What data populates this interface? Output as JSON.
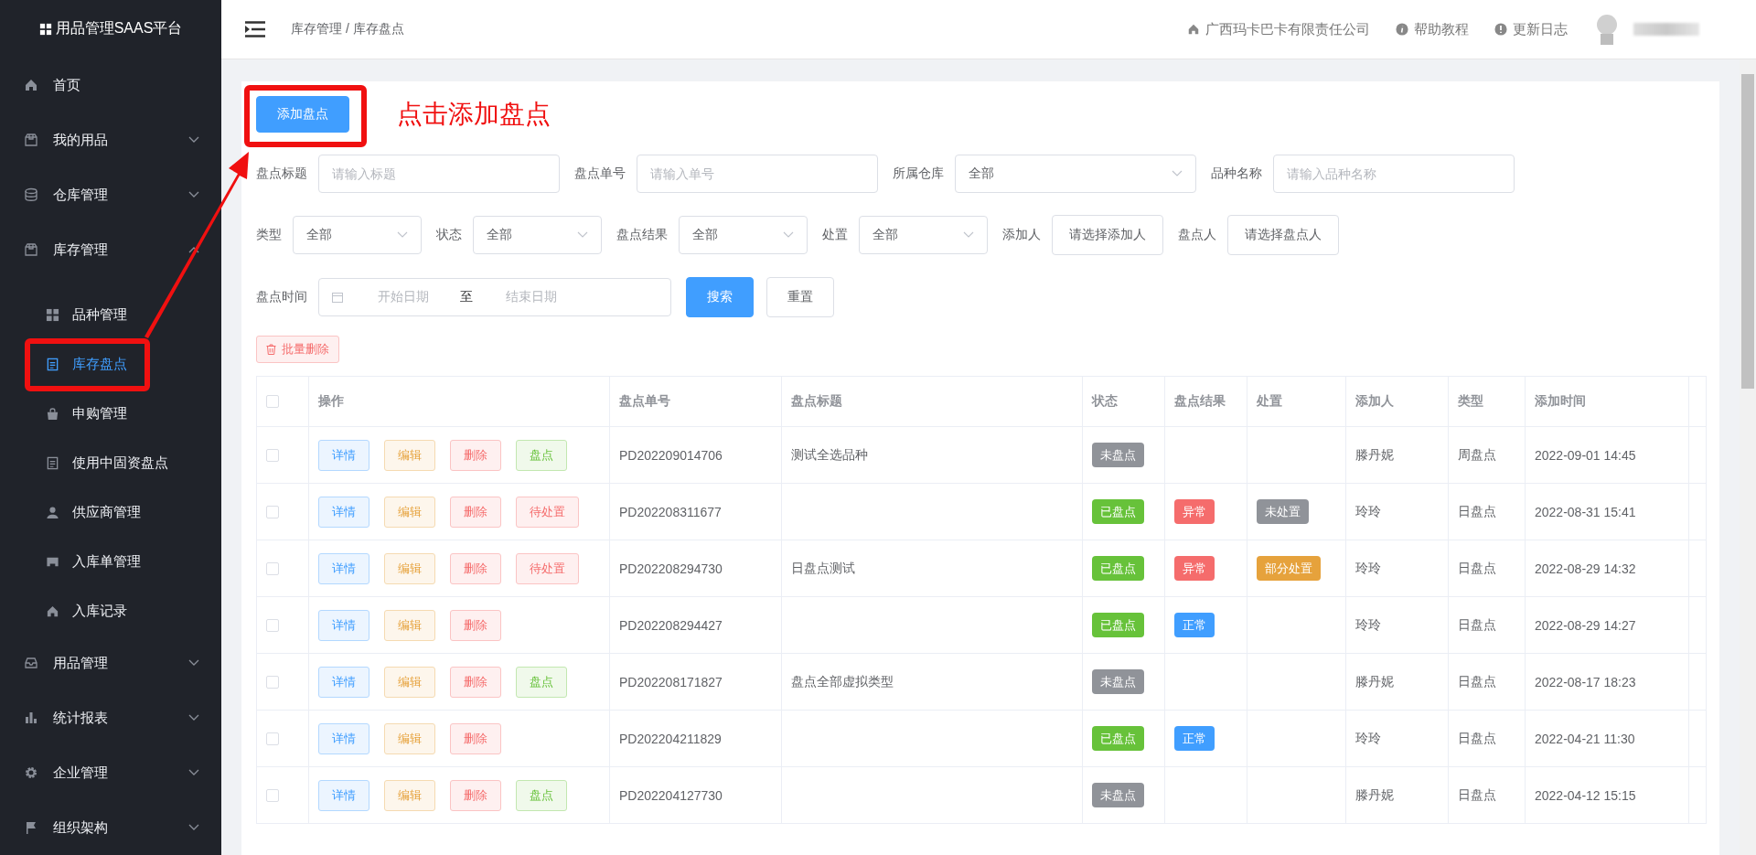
{
  "sidebar": {
    "logo": "用品管理SAAS平台",
    "items": [
      {
        "label": "首页",
        "kind": "link"
      },
      {
        "label": "我的用品",
        "kind": "group",
        "expanded": false
      },
      {
        "label": "仓库管理",
        "kind": "group",
        "expanded": false
      },
      {
        "label": "库存管理",
        "kind": "group",
        "expanded": true,
        "children": [
          {
            "label": "品种管理",
            "selected": false
          },
          {
            "label": "库存盘点",
            "selected": true
          },
          {
            "label": "申购管理",
            "selected": false
          },
          {
            "label": "使用中固资盘点",
            "selected": false
          },
          {
            "label": "供应商管理",
            "selected": false
          },
          {
            "label": "入库单管理",
            "selected": false
          },
          {
            "label": "入库记录",
            "selected": false
          }
        ]
      },
      {
        "label": "用品管理",
        "kind": "group",
        "expanded": false
      },
      {
        "label": "统计报表",
        "kind": "group",
        "expanded": false
      },
      {
        "label": "企业管理",
        "kind": "group",
        "expanded": false
      },
      {
        "label": "组织架构",
        "kind": "group",
        "expanded": false
      }
    ]
  },
  "header": {
    "breadcrumb": "库存管理 / 库存盘点",
    "company": "广西玛卡巴卡有限责任公司",
    "help": "帮助教程",
    "changelog": "更新日志"
  },
  "add_button": "添加盘点",
  "annotation": "点击添加盘点",
  "filters": [
    [
      {
        "label": "盘点标题",
        "kind": "input",
        "placeholder": "请输入标题"
      },
      {
        "label": "盘点单号",
        "kind": "input",
        "placeholder": "请输入单号"
      },
      {
        "label": "所属仓库",
        "kind": "select",
        "value": "全部"
      },
      {
        "label": "品种名称",
        "kind": "input",
        "placeholder": "请输入品种名称"
      }
    ],
    [
      {
        "label": "类型",
        "kind": "select",
        "value": "全部"
      },
      {
        "label": "状态",
        "kind": "select",
        "value": "全部"
      },
      {
        "label": "盘点结果",
        "kind": "select",
        "value": "全部"
      },
      {
        "label": "处置",
        "kind": "select",
        "value": "全部"
      },
      {
        "label": "添加人",
        "kind": "picker",
        "value": "请选择添加人"
      },
      {
        "label": "盘点人",
        "kind": "picker",
        "value": "请选择盘点人"
      }
    ],
    [
      {
        "label": "盘点时间",
        "kind": "daterange",
        "start_placeholder": "开始日期",
        "separator": "至",
        "end_placeholder": "结束日期"
      }
    ]
  ],
  "search_button": "搜索",
  "reset_button": "重置",
  "batch_delete_button": "批量删除",
  "table": {
    "all_checked": false,
    "columns": [
      "操作",
      "盘点单号",
      "盘点标题",
      "状态",
      "盘点结果",
      "处置",
      "添加人",
      "类型",
      "添加时间"
    ],
    "rows": [
      {
        "checked": false,
        "actions": [
          {
            "label": "详情",
            "kind": "info"
          },
          {
            "label": "编辑",
            "kind": "warning"
          },
          {
            "label": "删除",
            "kind": "danger"
          },
          {
            "label": "盘点",
            "kind": "success"
          }
        ],
        "number": "PD202209014706",
        "title": "测试全选品种",
        "status": {
          "label": "未盘点",
          "color": "#909399"
        },
        "adder": "滕丹妮",
        "type": "周盘点",
        "time": "2022-09-01 14:45"
      },
      {
        "checked": false,
        "actions": [
          {
            "label": "详情",
            "kind": "info"
          },
          {
            "label": "编辑",
            "kind": "warning"
          },
          {
            "label": "删除",
            "kind": "danger"
          },
          {
            "label": "待处置",
            "kind": "danger"
          }
        ],
        "number": "PD202208311677",
        "status": {
          "label": "已盘点",
          "color": "#67c23a"
        },
        "result": {
          "label": "异常",
          "color": "#f56c6c"
        },
        "disposal": {
          "label": "未处置",
          "color": "#909399"
        },
        "adder": "玲玲",
        "type": "日盘点",
        "time": "2022-08-31 15:41"
      },
      {
        "checked": false,
        "actions": [
          {
            "label": "详情",
            "kind": "info"
          },
          {
            "label": "编辑",
            "kind": "warning"
          },
          {
            "label": "删除",
            "kind": "danger"
          },
          {
            "label": "待处置",
            "kind": "danger"
          }
        ],
        "number": "PD202208294730",
        "title": "日盘点测试",
        "status": {
          "label": "已盘点",
          "color": "#67c23a"
        },
        "result": {
          "label": "异常",
          "color": "#f56c6c"
        },
        "disposal": {
          "label": "部分处置",
          "color": "#e6a23c"
        },
        "adder": "玲玲",
        "type": "日盘点",
        "time": "2022-08-29 14:32"
      },
      {
        "checked": false,
        "actions": [
          {
            "label": "详情",
            "kind": "info"
          },
          {
            "label": "编辑",
            "kind": "warning"
          },
          {
            "label": "删除",
            "kind": "danger"
          }
        ],
        "number": "PD202208294427",
        "status": {
          "label": "已盘点",
          "color": "#67c23a"
        },
        "result": {
          "label": "正常",
          "color": "#409eff"
        },
        "adder": "玲玲",
        "type": "日盘点",
        "time": "2022-08-29 14:27"
      },
      {
        "checked": false,
        "actions": [
          {
            "label": "详情",
            "kind": "info"
          },
          {
            "label": "编辑",
            "kind": "warning"
          },
          {
            "label": "删除",
            "kind": "danger"
          },
          {
            "label": "盘点",
            "kind": "success"
          }
        ],
        "number": "PD202208171827",
        "title": "盘点全部虚拟类型",
        "status": {
          "label": "未盘点",
          "color": "#909399"
        },
        "adder": "滕丹妮",
        "type": "日盘点",
        "time": "2022-08-17 18:23"
      },
      {
        "checked": false,
        "actions": [
          {
            "label": "详情",
            "kind": "info"
          },
          {
            "label": "编辑",
            "kind": "warning"
          },
          {
            "label": "删除",
            "kind": "danger"
          }
        ],
        "number": "PD202204211829",
        "status": {
          "label": "已盘点",
          "color": "#67c23a"
        },
        "result": {
          "label": "正常",
          "color": "#409eff"
        },
        "adder": "玲玲",
        "type": "日盘点",
        "time": "2022-04-21 11:30"
      },
      {
        "checked": false,
        "actions": [
          {
            "label": "详情",
            "kind": "info"
          },
          {
            "label": "编辑",
            "kind": "warning"
          },
          {
            "label": "删除",
            "kind": "danger"
          },
          {
            "label": "盘点",
            "kind": "success"
          }
        ],
        "number": "PD202204127730",
        "status": {
          "label": "未盘点",
          "color": "#909399"
        },
        "adder": "滕丹妮",
        "type": "日盘点",
        "time": "2022-04-12 15:15"
      }
    ]
  }
}
